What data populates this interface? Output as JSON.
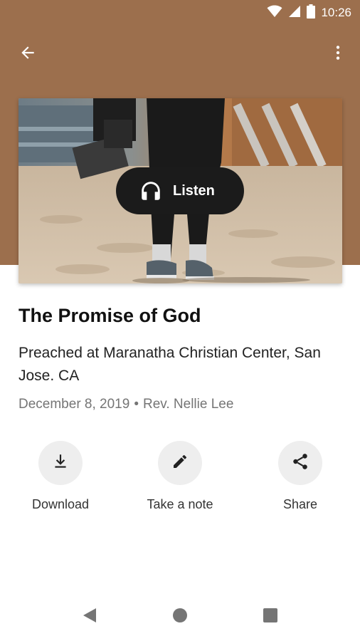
{
  "status_bar": {
    "time": "10:26",
    "icons": [
      "wifi-icon",
      "cellular-signal-icon",
      "battery-icon"
    ]
  },
  "app_bar": {
    "back_icon": "arrow-back-icon",
    "menu_icon": "more-vert-icon"
  },
  "hero": {
    "image": "photo of feet standing on sand beach",
    "listen_label": "Listen",
    "listen_icon": "headphones-icon"
  },
  "sermon": {
    "title": "The Promise of God",
    "subtitle": "Preached at Maranatha Christian Center, San Jose. CA",
    "date": "December 8, 2019",
    "separator": "•",
    "speaker": "Rev. Nellie Lee"
  },
  "actions": [
    {
      "label": "Download",
      "icon": "download-icon"
    },
    {
      "label": "Take a note",
      "icon": "pencil-icon"
    },
    {
      "label": "Share",
      "icon": "share-icon"
    }
  ],
  "nav": {
    "icons": [
      "nav-back-icon",
      "nav-home-icon",
      "nav-recents-icon"
    ]
  },
  "colors": {
    "header": "#9c6f4d",
    "listen_button": "#1b1b1b",
    "action_circle": "#eeeeee",
    "meta_text": "#757575"
  }
}
